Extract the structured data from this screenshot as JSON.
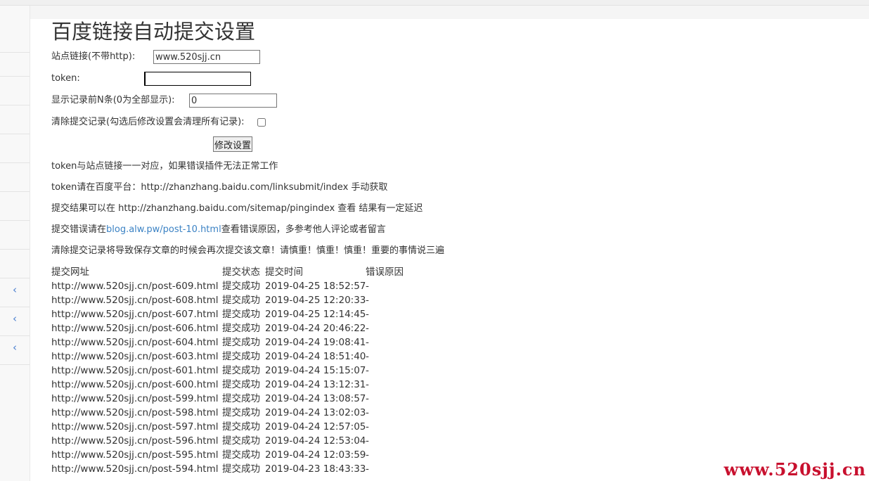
{
  "page": {
    "title": "百度链接自动提交设置"
  },
  "form": {
    "site_label": "站点链接(不带http):",
    "site_value": "www.520sjj.cn",
    "token_label": "token:",
    "token_value": "",
    "count_label": "显示记录前N条(0为全部显示):",
    "count_value": "0",
    "clear_label": "清除提交记录(勾选后修改设置会清理所有记录):",
    "clear_checked": false,
    "submit_label": "修改设置"
  },
  "notes": {
    "n1": "token与站点链接一一对应，如果错误插件无法正常工作",
    "n2": "token请在百度平台：http://zhanzhang.baidu.com/linksubmit/index 手动获取",
    "n3": "提交结果可以在 http://zhanzhang.baidu.com/sitemap/pingindex 查看 结果有一定延迟",
    "n4_prefix": "提交错误请在",
    "n4_link": "blog.alw.pw/post-10.html",
    "n4_suffix": "查看错误原因，多参考他人评论或者留言",
    "n5": "清除提交记录将导致保存文章的时候会再次提交该文章！请慎重！慎重！慎重！重要的事情说三遍"
  },
  "table": {
    "headers": [
      "提交网址",
      "提交状态",
      "提交时间",
      "错误原因"
    ],
    "rows": [
      [
        "http://www.520sjj.cn/post-609.html",
        "提交成功",
        "2019-04-25 18:52:57",
        "-"
      ],
      [
        "http://www.520sjj.cn/post-608.html",
        "提交成功",
        "2019-04-25 12:20:33",
        "-"
      ],
      [
        "http://www.520sjj.cn/post-607.html",
        "提交成功",
        "2019-04-25 12:14:45",
        "-"
      ],
      [
        "http://www.520sjj.cn/post-606.html",
        "提交成功",
        "2019-04-24 20:46:22",
        "-"
      ],
      [
        "http://www.520sjj.cn/post-604.html",
        "提交成功",
        "2019-04-24 19:08:41",
        "-"
      ],
      [
        "http://www.520sjj.cn/post-603.html",
        "提交成功",
        "2019-04-24 18:51:40",
        "-"
      ],
      [
        "http://www.520sjj.cn/post-601.html",
        "提交成功",
        "2019-04-24 15:15:07",
        "-"
      ],
      [
        "http://www.520sjj.cn/post-600.html",
        "提交成功",
        "2019-04-24 13:12:31",
        "-"
      ],
      [
        "http://www.520sjj.cn/post-599.html",
        "提交成功",
        "2019-04-24 13:08:57",
        "-"
      ],
      [
        "http://www.520sjj.cn/post-598.html",
        "提交成功",
        "2019-04-24 13:02:03",
        "-"
      ],
      [
        "http://www.520sjj.cn/post-597.html",
        "提交成功",
        "2019-04-24 12:57:05",
        "-"
      ],
      [
        "http://www.520sjj.cn/post-596.html",
        "提交成功",
        "2019-04-24 12:53:04",
        "-"
      ],
      [
        "http://www.520sjj.cn/post-595.html",
        "提交成功",
        "2019-04-24 12:03:59",
        "-"
      ],
      [
        "http://www.520sjj.cn/post-594.html",
        "提交成功",
        "2019-04-23 18:43:33",
        "-"
      ]
    ]
  },
  "sidebar": {
    "icons": [
      "chevron-left-icon",
      "chevron-left-icon",
      "chevron-left-icon"
    ]
  },
  "watermark": "www.520sjj.cn",
  "colors": {
    "link": "#3b82c4",
    "watermark": "#c8102e",
    "sidebar_chevron": "#4a7fcf"
  }
}
